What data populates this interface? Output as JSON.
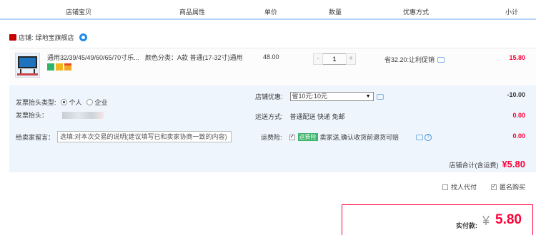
{
  "header": {
    "col_item": "店铺宝贝",
    "col_attr": "商品属性",
    "col_price": "单价",
    "col_qty": "数量",
    "col_promo": "优惠方式",
    "col_subtotal": "小计"
  },
  "shop": {
    "prefix": "店铺:",
    "name": "绿地宝旗舰店"
  },
  "item": {
    "title": "通用32/39/45/49/60/65/70寸乐...",
    "attr": "颜色分类：A款 普通(17-32寸)通用",
    "price": "48.00",
    "qty": "1",
    "qty_minus": "-",
    "qty_plus": "+",
    "promo": "省32.20:让利促销",
    "subtotal": "15.80"
  },
  "invoice": {
    "type_label": "发票抬头类型:",
    "opt_personal": "个人",
    "opt_company": "企业",
    "title_label": "发票抬头：",
    "memo_label": "给卖家留言：",
    "memo_placeholder": "选填:对本次交易的说明(建议填写已和卖家协商一致的内容)"
  },
  "shop_discount": {
    "label": "店铺优惠:",
    "selected": "省10元:10元",
    "value": "-10.00"
  },
  "shipping": {
    "label": "运送方式:",
    "method": "普通配送 快递 免邮",
    "value": "0.00"
  },
  "insurance": {
    "label": "运费险:",
    "tag": "运费险",
    "text": "卖家送,确认收货前退货可赔",
    "value": "0.00"
  },
  "shop_total": {
    "label": "店铺合计(含运费)",
    "value": "¥5.80"
  },
  "options": {
    "proxy_pay": "找人代付",
    "anonymous": "匿名购买"
  },
  "pay": {
    "label": "实付款:",
    "currency": "¥",
    "amount": "5.80"
  },
  "colors": {
    "accent": "#ff0036",
    "link": "#1e8ae7",
    "panel": "#eef5fd"
  }
}
